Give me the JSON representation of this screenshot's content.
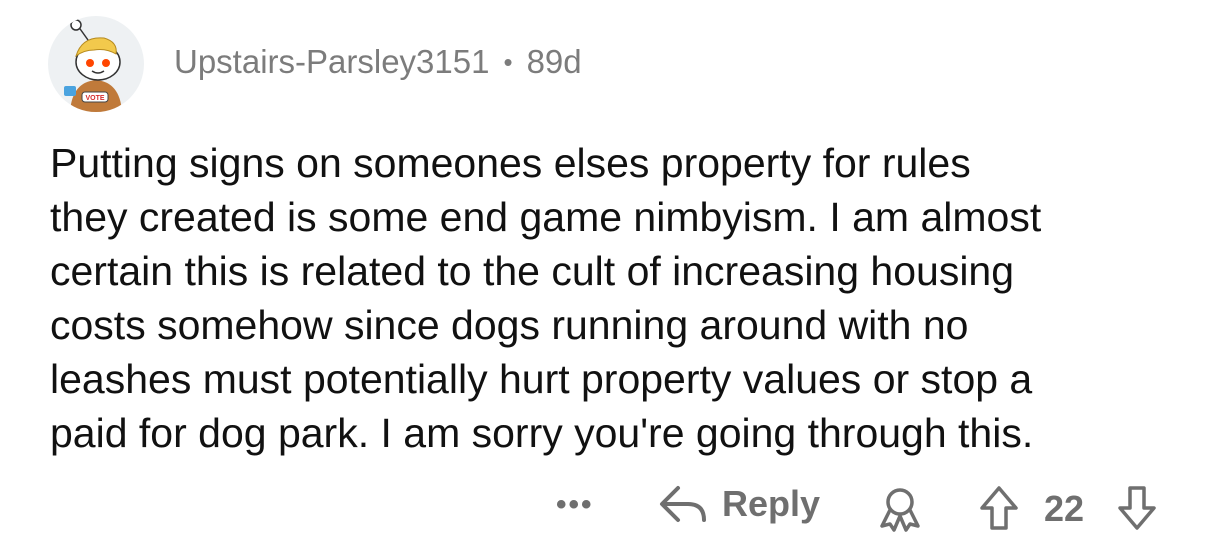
{
  "comment": {
    "author": "Upstairs-Parsley3151",
    "separator": "•",
    "age": "89d",
    "body_lines": [
      "Putting signs on someones elses property for rules",
      "they created is some end game nimbyism. I am almost",
      "certain this is related to the cult of increasing housing",
      "costs somehow since dogs running around with no",
      "leashes must potentially hurt property values or stop a",
      "paid for dog park. I am sorry you're going through this."
    ]
  },
  "actions": {
    "more_label": "•••",
    "reply_label": "Reply",
    "score": "22"
  },
  "icons": {
    "avatar": "reddit-snoo-avatar",
    "reply": "reply-arrow-icon",
    "award": "award-icon",
    "upvote": "upvote-arrow-icon",
    "downvote": "downvote-arrow-icon"
  },
  "colors": {
    "text": "#111111",
    "meta": "#7c7c7c",
    "action": "#6f6f6f",
    "avatar_bg": "#eef1f3"
  }
}
